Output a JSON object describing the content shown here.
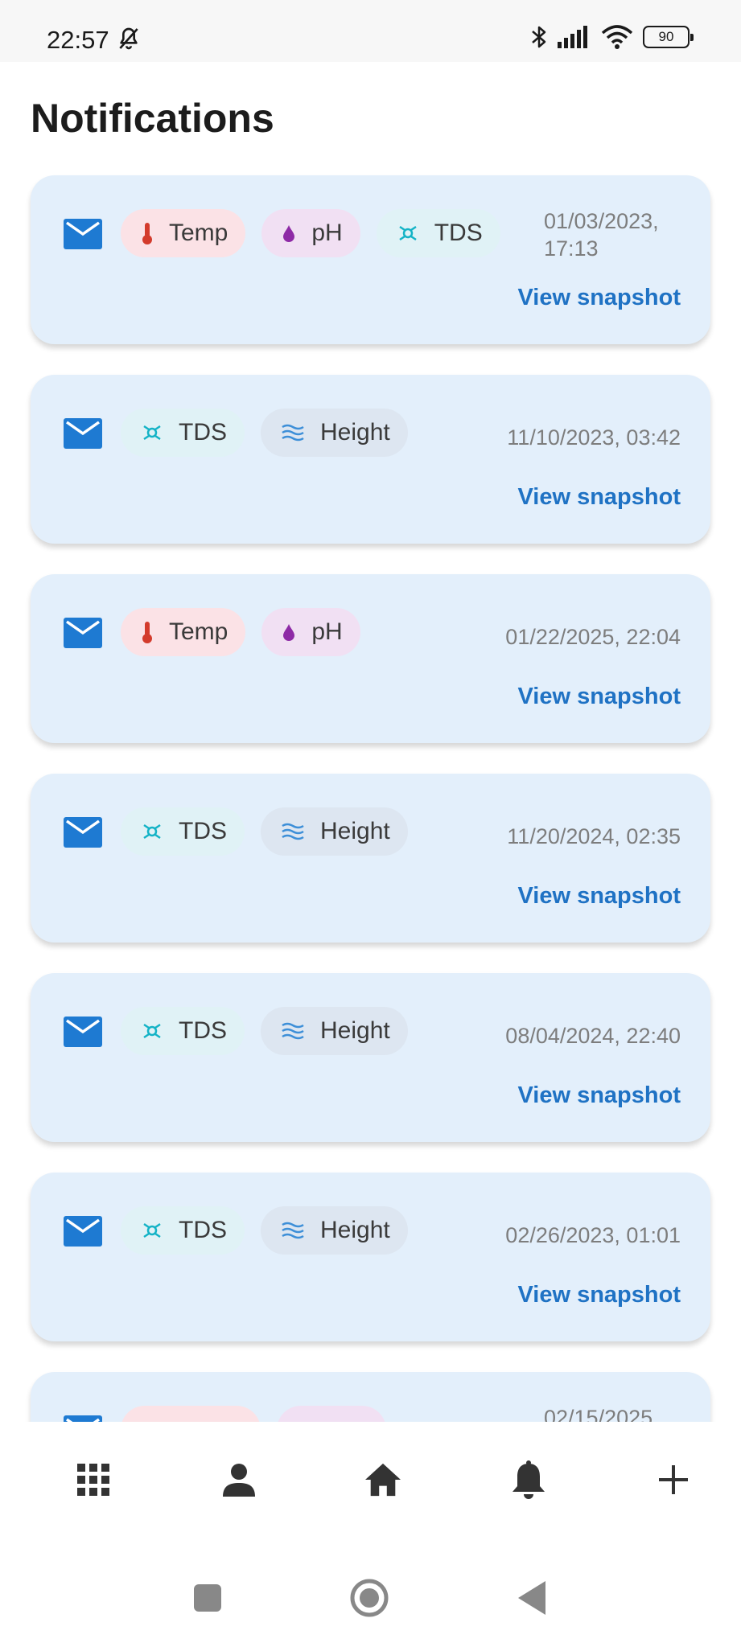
{
  "status_bar": {
    "time": "22:57",
    "battery": "90"
  },
  "page": {
    "title": "Notifications"
  },
  "notifications": [
    {
      "chips": [
        {
          "label": "Temp",
          "icon": "thermometer-icon"
        },
        {
          "label": "pH",
          "icon": "drop-icon"
        },
        {
          "label": "TDS",
          "icon": "tds-icon"
        }
      ],
      "timestamp": "01/03/2023, 17:13",
      "link": "View snapshot"
    },
    {
      "chips": [
        {
          "label": "TDS",
          "icon": "tds-icon"
        },
        {
          "label": "Height",
          "icon": "waves-icon"
        }
      ],
      "timestamp": "11/10/2023, 03:42",
      "link": "View snapshot"
    },
    {
      "chips": [
        {
          "label": "Temp",
          "icon": "thermometer-icon"
        },
        {
          "label": "pH",
          "icon": "drop-icon"
        }
      ],
      "timestamp": "01/22/2025, 22:04",
      "link": "View snapshot"
    },
    {
      "chips": [
        {
          "label": "TDS",
          "icon": "tds-icon"
        },
        {
          "label": "Height",
          "icon": "waves-icon"
        }
      ],
      "timestamp": "11/20/2024, 02:35",
      "link": "View snapshot"
    },
    {
      "chips": [
        {
          "label": "TDS",
          "icon": "tds-icon"
        },
        {
          "label": "Height",
          "icon": "waves-icon"
        }
      ],
      "timestamp": "08/04/2024, 22:40",
      "link": "View snapshot"
    },
    {
      "chips": [
        {
          "label": "TDS",
          "icon": "tds-icon"
        },
        {
          "label": "Height",
          "icon": "waves-icon"
        }
      ],
      "timestamp": "02/26/2023, 01:01",
      "link": "View snapshot"
    },
    {
      "chips": [
        {
          "label": "",
          "icon": "thermometer-icon"
        },
        {
          "label": "",
          "icon": "drop-icon"
        }
      ],
      "timestamp": "02/15/2025,",
      "link": ""
    }
  ],
  "colors": {
    "card_background": "#e3effb",
    "accent": "#1f72c4",
    "mail_icon": "#1e7ad2",
    "temp_chip": "#fbe2e6",
    "ph_chip": "#f1e0f3",
    "tds_chip": "#e0f2f6",
    "height_chip": "#dde6f1"
  },
  "bottom_nav": [
    {
      "name": "apps-grid-icon"
    },
    {
      "name": "profile-icon"
    },
    {
      "name": "home-icon"
    },
    {
      "name": "notifications-bell-icon"
    },
    {
      "name": "add-icon"
    }
  ],
  "system_nav": [
    "recents-button",
    "home-system-button",
    "back-button"
  ]
}
